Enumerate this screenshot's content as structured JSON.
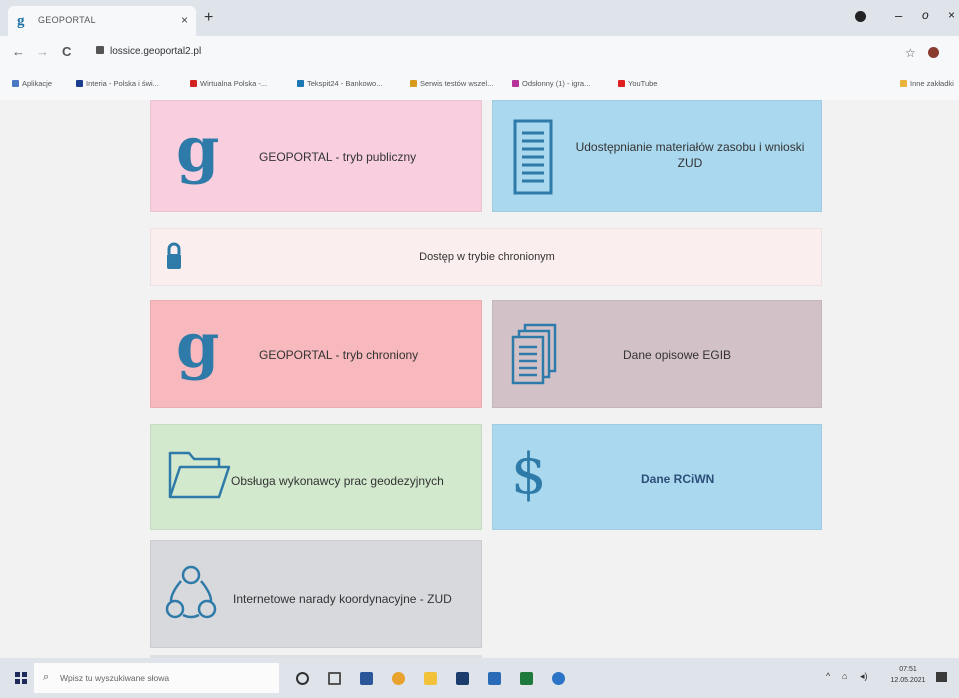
{
  "browser": {
    "tab_title": "GEOPORTAL",
    "tab_close": "×",
    "new_tab": "+",
    "url": "lossice.geoportal2.pl",
    "win_min": "–",
    "win_max": "o",
    "win_close": "×",
    "nav": {
      "back": "←",
      "forward": "→",
      "reload": "C"
    },
    "star": "☆",
    "bookmarks": [
      {
        "label": "Aplikacje",
        "color": "#4a78c4"
      },
      {
        "label": "Interia - Polska i świ...",
        "color": "#1b3d8f"
      },
      {
        "label": "Wirtualna Polska -...",
        "color": "#d32222"
      },
      {
        "label": "Tekspit24 - Bankowo...",
        "color": "#1b78b4"
      },
      {
        "label": "Serwis testów wszel...",
        "color": "#d79a1d"
      },
      {
        "label": "Odsłonny (1) - igra...",
        "color": "#b4329a"
      },
      {
        "label": "YouTube",
        "color": "#e02020"
      }
    ],
    "bookmarks_other": "Inne zakładki"
  },
  "tiles": {
    "geoportal_public": "GEOPORTAL - tryb publiczny",
    "udostepnianie": "Udostępnianie materiałów zasobu i wnioski ZUD",
    "dostep": "Dostęp w trybie chronionym",
    "geoportal_protected": "GEOPORTAL - tryb chroniony",
    "dane_egib": "Dane opisowe EGIB",
    "obsluga": "Obsługa wykonawcy prac geodezyjnych",
    "dane_rcwn": "Dane RCiWN",
    "narady": "Internetowe narady koordynacyjne - ZUD",
    "g_letter": "g",
    "dollar": "$"
  },
  "colors": {
    "pink": "#f9cfe0",
    "blue": "#aad8ee",
    "cream": "#fbeeee",
    "salmon": "#f7b9bd",
    "mauve": "#d2c2c7",
    "green": "#d2e9ce",
    "gray": "#d7d9dd",
    "icon_blue": "#2e7aa8"
  },
  "taskbar": {
    "search_placeholder": "Wpisz tu wyszukiwane słowa",
    "search_icon": "⌕",
    "tray_arrow": "^",
    "tray_network": "⌂",
    "tray_sound": "◂)",
    "time": "07:51",
    "date": "12.05.2021"
  }
}
